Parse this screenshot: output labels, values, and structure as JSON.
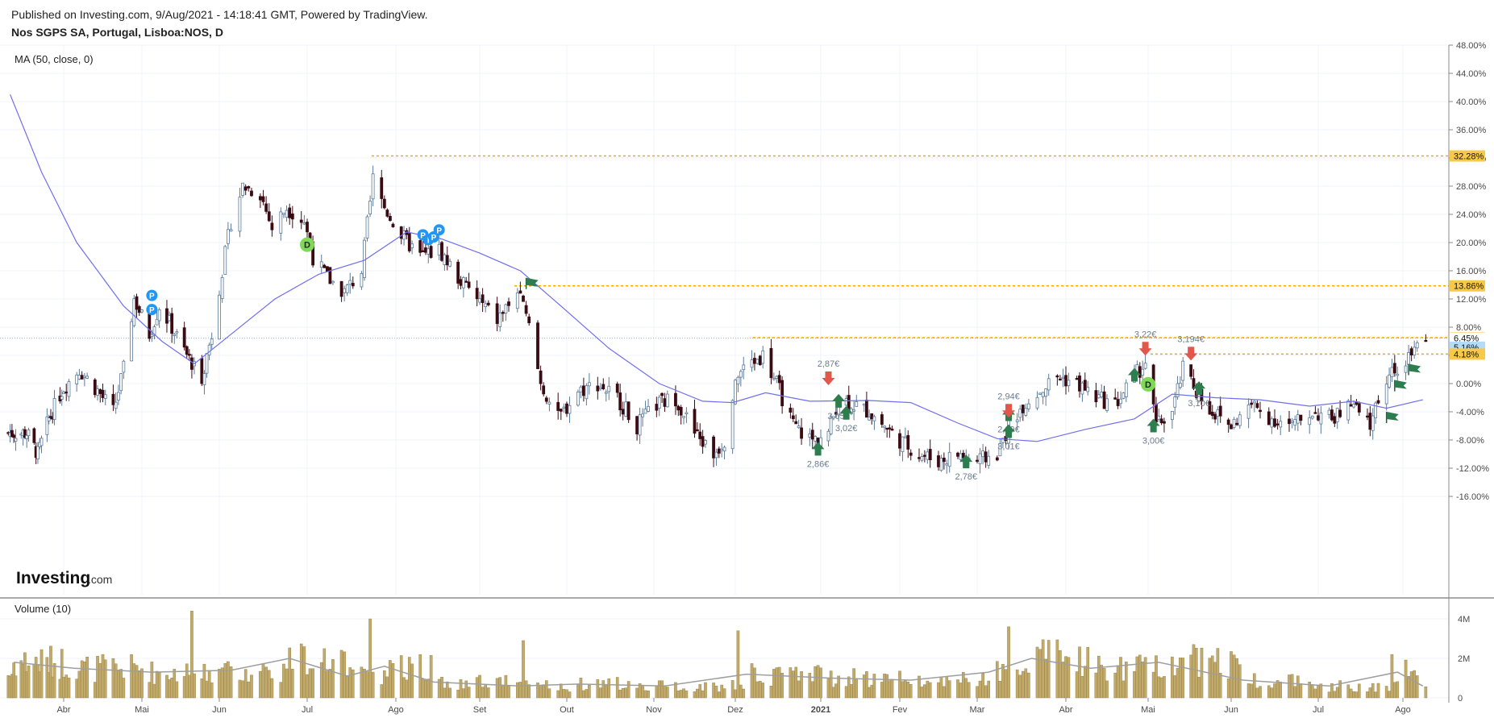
{
  "header": {
    "published": "Published on Investing.com, 9/Aug/2021 - 14:18:41 GMT, Powered by TradingView.",
    "symbol": "Nos SGPS SA, Portugal, Lisboa:NOS, D"
  },
  "logo": {
    "brand": "Investing",
    "suffix": ".com"
  },
  "colors": {
    "ma_line": "#6f6ff0",
    "candle_up_fill": "#ffffff",
    "candle_up_border": "#5a7a9b",
    "candle_down": "#3a0b12",
    "volume_bar": "#c2aa6a",
    "volume_ma": "#9e9e9e",
    "level_line": "#f5a800",
    "tag_yellow": "#f7c948",
    "tag_blue": "#b5dcf7",
    "marker_up": "#2e7d4f",
    "marker_down": "#e2574c",
    "marker_p": "#2196f3",
    "marker_d": "#7ed957"
  },
  "chart_data": [
    {
      "type": "line",
      "panel": "price",
      "title": "Nos SGPS SA, Portugal, Lisboa:NOS, D",
      "indicator": "MA (50, close, 0)",
      "y_unit": "%",
      "ylim": [
        -16,
        48
      ],
      "y_ticks": [
        "48.00%",
        "44.00%",
        "40.00%",
        "36.00%",
        "32.00%",
        "28.00%",
        "24.00%",
        "20.00%",
        "16.00%",
        "12.00%",
        "8.00%",
        "4.00%",
        "0.00%",
        "-4.00%",
        "-8.00%",
        "-12.00%",
        "-16.00%"
      ],
      "x_ticks": [
        "Abr",
        "Mai",
        "Jun",
        "Jul",
        "Ago",
        "Set",
        "Out",
        "Nov",
        "Dez",
        "2021",
        "Fev",
        "Mar",
        "Abr",
        "Mai",
        "Jun",
        "Jul",
        "Ago"
      ],
      "price_close": [
        {
          "x": "2020-03-12",
          "y": -7
        },
        {
          "x": "2020-03-18",
          "y": -10
        },
        {
          "x": "2020-03-24",
          "y": -5
        },
        {
          "x": "2020-03-31",
          "y": -1
        },
        {
          "x": "2020-04-07",
          "y": 2
        },
        {
          "x": "2020-04-14",
          "y": -1
        },
        {
          "x": "2020-04-20",
          "y": -4
        },
        {
          "x": "2020-04-24",
          "y": 2
        },
        {
          "x": "2020-04-28",
          "y": 12
        },
        {
          "x": "2020-05-04",
          "y": 7
        },
        {
          "x": "2020-05-08",
          "y": 11
        },
        {
          "x": "2020-05-13",
          "y": 8
        },
        {
          "x": "2020-05-19",
          "y": 4
        },
        {
          "x": "2020-05-25",
          "y": 1
        },
        {
          "x": "2020-05-29",
          "y": 7
        },
        {
          "x": "2020-06-02",
          "y": 16
        },
        {
          "x": "2020-06-05",
          "y": 23
        },
        {
          "x": "2020-06-09",
          "y": 28
        },
        {
          "x": "2020-06-15",
          "y": 27
        },
        {
          "x": "2020-06-19",
          "y": 22
        },
        {
          "x": "2020-06-24",
          "y": 25
        },
        {
          "x": "2020-06-30",
          "y": 23
        },
        {
          "x": "2020-07-03",
          "y": 18
        },
        {
          "x": "2020-07-08",
          "y": 15
        },
        {
          "x": "2020-07-14",
          "y": 13
        },
        {
          "x": "2020-07-20",
          "y": 16
        },
        {
          "x": "2020-07-24",
          "y": 29
        },
        {
          "x": "2020-07-28",
          "y": 25
        },
        {
          "x": "2020-08-03",
          "y": 21
        },
        {
          "x": "2020-08-10",
          "y": 18
        },
        {
          "x": "2020-08-17",
          "y": 19
        },
        {
          "x": "2020-08-24",
          "y": 15
        },
        {
          "x": "2020-08-31",
          "y": 12
        },
        {
          "x": "2020-09-07",
          "y": 9
        },
        {
          "x": "2020-09-14",
          "y": 13
        },
        {
          "x": "2020-09-18",
          "y": 8
        },
        {
          "x": "2020-09-22",
          "y": 0
        },
        {
          "x": "2020-09-28",
          "y": -5
        },
        {
          "x": "2020-10-05",
          "y": -1
        },
        {
          "x": "2020-10-12",
          "y": 0
        },
        {
          "x": "2020-10-19",
          "y": -2
        },
        {
          "x": "2020-10-26",
          "y": -6
        },
        {
          "x": "2020-11-02",
          "y": -3
        },
        {
          "x": "2020-11-09",
          "y": -2
        },
        {
          "x": "2020-11-16",
          "y": -7
        },
        {
          "x": "2020-11-23",
          "y": -10
        },
        {
          "x": "2020-11-27",
          "y": -8
        },
        {
          "x": "2020-12-01",
          "y": 1
        },
        {
          "x": "2020-12-07",
          "y": 3
        },
        {
          "x": "2020-12-11",
          "y": 4
        },
        {
          "x": "2020-12-16",
          "y": 0
        },
        {
          "x": "2020-12-22",
          "y": -6
        },
        {
          "x": "2020-12-29",
          "y": -8
        },
        {
          "x": "2021-01-04",
          "y": -7
        },
        {
          "x": "2021-01-08",
          "y": -2
        },
        {
          "x": "2021-01-14",
          "y": -3
        },
        {
          "x": "2021-01-20",
          "y": -4
        },
        {
          "x": "2021-01-26",
          "y": -6
        },
        {
          "x": "2021-02-01",
          "y": -8
        },
        {
          "x": "2021-02-08",
          "y": -10
        },
        {
          "x": "2021-02-15",
          "y": -11
        },
        {
          "x": "2021-02-22",
          "y": -10
        },
        {
          "x": "2021-03-01",
          "y": -11
        },
        {
          "x": "2021-03-08",
          "y": -10
        },
        {
          "x": "2021-03-12",
          "y": -6
        },
        {
          "x": "2021-03-17",
          "y": -3
        },
        {
          "x": "2021-03-23",
          "y": -1
        },
        {
          "x": "2021-03-29",
          "y": 1
        },
        {
          "x": "2021-04-05",
          "y": 0
        },
        {
          "x": "2021-04-12",
          "y": -2
        },
        {
          "x": "2021-04-19",
          "y": -3
        },
        {
          "x": "2021-04-26",
          "y": 1
        },
        {
          "x": "2021-04-30",
          "y": 3
        },
        {
          "x": "2021-05-04",
          "y": -6
        },
        {
          "x": "2021-05-10",
          "y": -4
        },
        {
          "x": "2021-05-14",
          "y": 2
        },
        {
          "x": "2021-05-19",
          "y": -1
        },
        {
          "x": "2021-05-25",
          "y": -4
        },
        {
          "x": "2021-06-01",
          "y": -6
        },
        {
          "x": "2021-06-08",
          "y": -3
        },
        {
          "x": "2021-06-15",
          "y": -5
        },
        {
          "x": "2021-06-22",
          "y": -6
        },
        {
          "x": "2021-06-29",
          "y": -4
        },
        {
          "x": "2021-07-06",
          "y": -5
        },
        {
          "x": "2021-07-13",
          "y": -3
        },
        {
          "x": "2021-07-20",
          "y": -6
        },
        {
          "x": "2021-07-23",
          "y": -2
        },
        {
          "x": "2021-07-28",
          "y": 2
        },
        {
          "x": "2021-08-02",
          "y": 3
        },
        {
          "x": "2021-08-06",
          "y": 5
        }
      ],
      "ma_50": [
        {
          "x": "2020-03-03",
          "y": 41
        },
        {
          "x": "2020-03-20",
          "y": 30
        },
        {
          "x": "2020-04-06",
          "y": 20
        },
        {
          "x": "2020-04-24",
          "y": 11
        },
        {
          "x": "2020-05-09",
          "y": 6
        },
        {
          "x": "2020-05-22",
          "y": 2.8
        },
        {
          "x": "2020-06-05",
          "y": 7
        },
        {
          "x": "2020-06-20",
          "y": 12
        },
        {
          "x": "2020-07-05",
          "y": 15.5
        },
        {
          "x": "2020-07-21",
          "y": 17.5
        },
        {
          "x": "2020-08-05",
          "y": 21.5
        },
        {
          "x": "2020-08-18",
          "y": 20.5
        },
        {
          "x": "2020-09-01",
          "y": 18.5
        },
        {
          "x": "2020-09-15",
          "y": 16
        },
        {
          "x": "2020-09-29",
          "y": 11
        },
        {
          "x": "2020-10-16",
          "y": 5
        },
        {
          "x": "2020-11-03",
          "y": 0
        },
        {
          "x": "2020-11-19",
          "y": -2.5
        },
        {
          "x": "2020-11-30",
          "y": -2.7
        },
        {
          "x": "2020-12-12",
          "y": -1.3
        },
        {
          "x": "2020-12-28",
          "y": -2.5
        },
        {
          "x": "2021-01-20",
          "y": -2.4
        },
        {
          "x": "2021-02-05",
          "y": -2.7
        },
        {
          "x": "2021-02-22",
          "y": -5.6
        },
        {
          "x": "2021-03-08",
          "y": -7.8
        },
        {
          "x": "2021-03-22",
          "y": -8.2
        },
        {
          "x": "2021-04-08",
          "y": -6.5
        },
        {
          "x": "2021-04-26",
          "y": -5
        },
        {
          "x": "2021-05-10",
          "y": -1.5
        },
        {
          "x": "2021-05-26",
          "y": -2
        },
        {
          "x": "2021-06-11",
          "y": -2.3
        },
        {
          "x": "2021-06-28",
          "y": -3.2
        },
        {
          "x": "2021-07-14",
          "y": -2.5
        },
        {
          "x": "2021-07-26",
          "y": -3.5
        },
        {
          "x": "2021-08-08",
          "y": -2.3
        }
      ],
      "horizontal_levels": [
        {
          "value": 32.28,
          "label": "32.28%",
          "style": "yellow"
        },
        {
          "value": 13.86,
          "label": "13.86%",
          "style": "yellow"
        },
        {
          "value": 6.51,
          "label": "6.51%",
          "style": "yellow"
        },
        {
          "value": 6.45,
          "label": "6.45%",
          "style": "plain"
        },
        {
          "value": 5.16,
          "label": "5.16%",
          "style": "blue"
        },
        {
          "value": 4.18,
          "label": "4.18%",
          "style": "yellow"
        }
      ],
      "markers": [
        {
          "x": "2020-05-05",
          "y": 10.5,
          "kind": "P"
        },
        {
          "x": "2020-05-05",
          "y": 12.5,
          "kind": "P"
        },
        {
          "x": "2020-07-01",
          "y": 19.7,
          "kind": "D"
        },
        {
          "x": "2020-08-11",
          "y": 21.1,
          "kind": "P"
        },
        {
          "x": "2020-08-13",
          "y": 20.4,
          "kind": "I"
        },
        {
          "x": "2020-08-15",
          "y": 20.8,
          "kind": "P"
        },
        {
          "x": "2020-08-17",
          "y": 21.8,
          "kind": "P"
        },
        {
          "x": "2020-09-17",
          "y": 14.2,
          "kind": "flag"
        },
        {
          "x": "2020-12-31",
          "y": -9.3,
          "kind": "up",
          "label": "2,86€"
        },
        {
          "x": "2021-01-04",
          "y": 0.8,
          "kind": "down",
          "label": "2,87€"
        },
        {
          "x": "2021-01-08",
          "y": -2.5,
          "kind": "up",
          "label": "3,05€"
        },
        {
          "x": "2021-01-11",
          "y": -4.2,
          "kind": "up",
          "label": "3,02€"
        },
        {
          "x": "2021-02-25",
          "y": -11.1,
          "kind": "up",
          "label": "2,78€"
        },
        {
          "x": "2021-03-12",
          "y": -4.4,
          "kind": "up",
          "label": "2,99€"
        },
        {
          "x": "2021-03-12",
          "y": -3.8,
          "kind": "down",
          "label": "2,94€"
        },
        {
          "x": "2021-03-12",
          "y": -6.8,
          "kind": "up",
          "label": "3,01€"
        },
        {
          "x": "2021-04-26",
          "y": 1.2,
          "kind": "up"
        },
        {
          "x": "2021-04-30",
          "y": 5.0,
          "kind": "down",
          "label": "3,22€"
        },
        {
          "x": "2021-05-01",
          "y": -0.1,
          "kind": "D",
          "label": "3,15€"
        },
        {
          "x": "2021-05-03",
          "y": -6.0,
          "kind": "up",
          "label": "3,00€"
        },
        {
          "x": "2021-05-17",
          "y": 4.3,
          "kind": "down",
          "label": "3,194€"
        },
        {
          "x": "2021-05-20",
          "y": -0.7,
          "kind": "up",
          "label": "3,10€"
        },
        {
          "x": "2021-07-26",
          "y": -4.8,
          "kind": "flag"
        },
        {
          "x": "2021-07-29",
          "y": -0.3,
          "kind": "flag"
        },
        {
          "x": "2021-08-03",
          "y": 2.0,
          "kind": "flag"
        }
      ]
    },
    {
      "type": "bar",
      "panel": "volume",
      "indicator": "Volume (10)",
      "ylim": [
        0,
        4.5
      ],
      "y_unit": "M",
      "y_ticks": [
        "4M",
        "2M",
        "0"
      ],
      "spikes": [
        {
          "x": "2020-05-21",
          "y": 4.4
        },
        {
          "x": "2020-07-23",
          "y": 4.0
        },
        {
          "x": "2020-09-16",
          "y": 2.9
        },
        {
          "x": "2020-12-02",
          "y": 3.4
        },
        {
          "x": "2021-03-12",
          "y": 3.6
        },
        {
          "x": "2021-05-01",
          "y": 3.1
        },
        {
          "x": "2021-05-18",
          "y": 2.7
        },
        {
          "x": "2021-07-28",
          "y": 2.2
        }
      ],
      "volume_ma_10": [
        {
          "x": "2020-03-05",
          "y": 1.8
        },
        {
          "x": "2020-04-05",
          "y": 1.5
        },
        {
          "x": "2020-05-05",
          "y": 1.3
        },
        {
          "x": "2020-06-05",
          "y": 1.4
        },
        {
          "x": "2020-06-25",
          "y": 2.0
        },
        {
          "x": "2020-07-15",
          "y": 1.1
        },
        {
          "x": "2020-07-28",
          "y": 1.6
        },
        {
          "x": "2020-08-15",
          "y": 0.8
        },
        {
          "x": "2020-09-15",
          "y": 0.6
        },
        {
          "x": "2020-10-05",
          "y": 0.7
        },
        {
          "x": "2020-11-05",
          "y": 0.6
        },
        {
          "x": "2020-12-05",
          "y": 1.2
        },
        {
          "x": "2021-01-05",
          "y": 1.0
        },
        {
          "x": "2021-02-05",
          "y": 0.9
        },
        {
          "x": "2021-03-05",
          "y": 1.3
        },
        {
          "x": "2021-03-20",
          "y": 2.0
        },
        {
          "x": "2021-04-10",
          "y": 1.5
        },
        {
          "x": "2021-05-05",
          "y": 1.8
        },
        {
          "x": "2021-06-05",
          "y": 0.9
        },
        {
          "x": "2021-07-05",
          "y": 0.6
        },
        {
          "x": "2021-07-30",
          "y": 1.3
        },
        {
          "x": "2021-08-08",
          "y": 0.6
        }
      ]
    }
  ]
}
